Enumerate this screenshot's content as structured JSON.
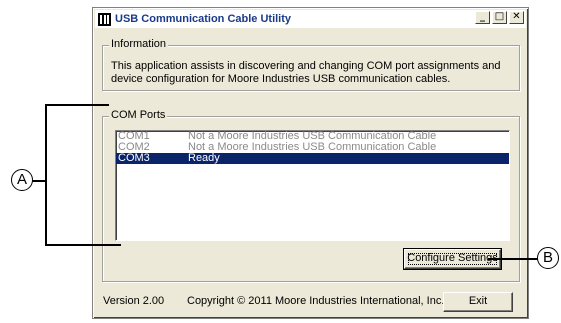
{
  "window": {
    "title": "USB Communication Cable Utility",
    "minimize": "_",
    "maximize": "□",
    "close": "✕"
  },
  "information": {
    "legend": "Information",
    "text": "This application assists in discovering and changing COM port assignments and device configuration for Moore Industries USB communication cables."
  },
  "com_ports": {
    "legend": "COM Ports",
    "rows": [
      {
        "port": "COM1",
        "status": "Not a Moore Industries USB Communication Cable",
        "selected": false
      },
      {
        "port": "COM2",
        "status": "Not a Moore Industries USB Communication Cable",
        "selected": false
      },
      {
        "port": "COM3",
        "status": "Ready",
        "selected": true
      }
    ],
    "configure_label": "Configure Settings"
  },
  "footer": {
    "version": "Version 2.00",
    "copyright": "Copyright © 2011 Moore Industries International, Inc.",
    "exit_label": "Exit"
  },
  "callouts": {
    "a": "A",
    "b": "B"
  }
}
